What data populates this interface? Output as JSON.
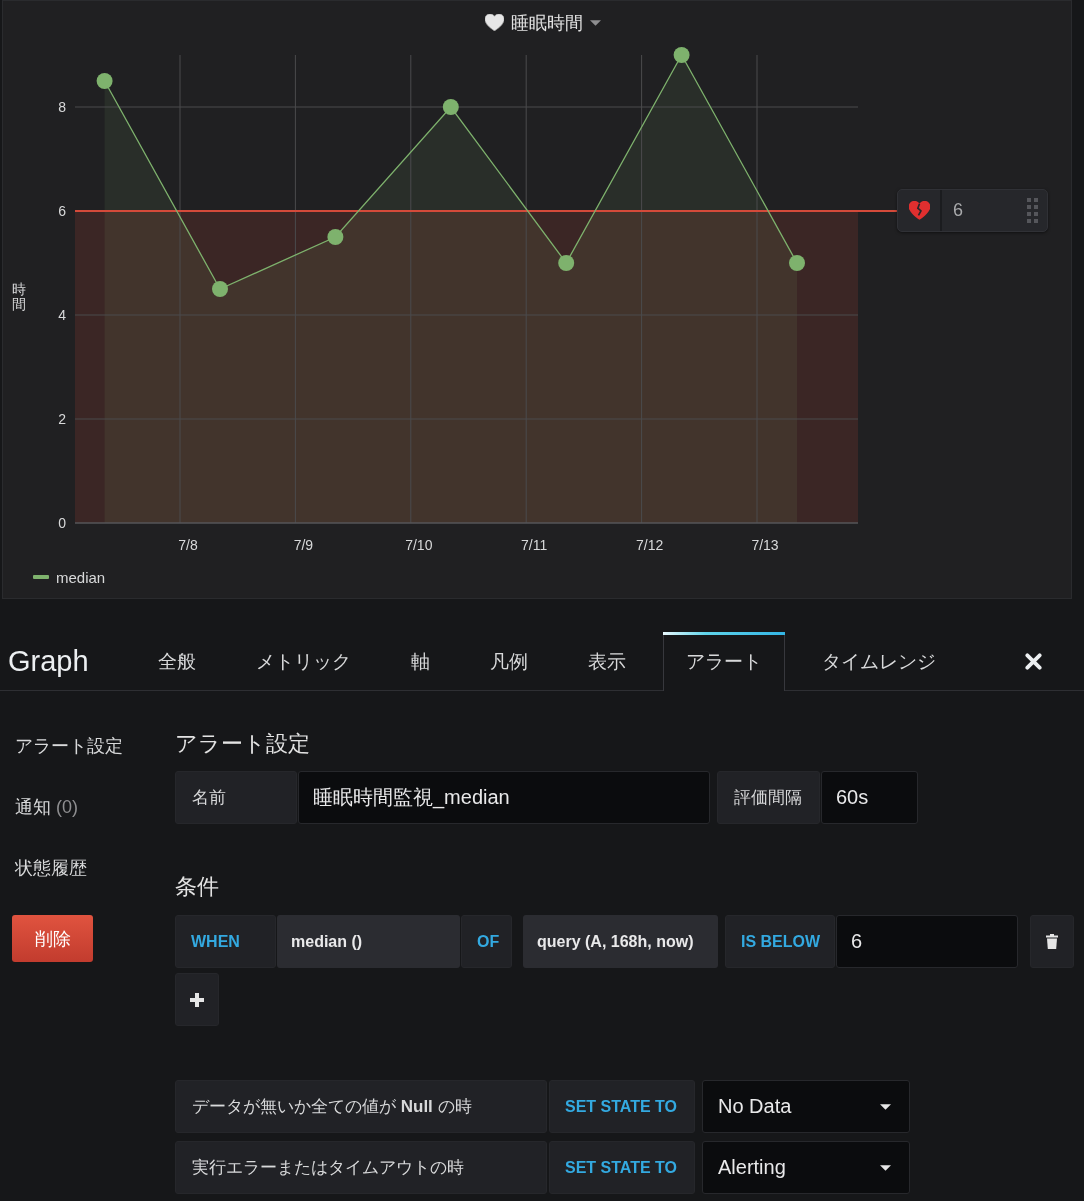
{
  "panel": {
    "title": "睡眠時間",
    "chart_data": {
      "type": "area",
      "ylabel": "時間",
      "categories": [
        null,
        "7/8",
        "7/9",
        "7/10",
        "7/11",
        "7/12",
        "7/13"
      ],
      "series": [
        {
          "name": "median",
          "color": "#7eb26d",
          "values": [
            8.5,
            4.5,
            5.5,
            8,
            5,
            9,
            5
          ]
        }
      ],
      "ylim": [
        0,
        9
      ],
      "yticks": [
        0,
        2,
        4,
        6,
        8
      ],
      "grid": true,
      "ref_lines": [
        {
          "axis": "y",
          "value": 6,
          "color": "#d44a3a"
        }
      ],
      "bands": [
        {
          "axis": "y",
          "from": 0,
          "to": 6,
          "color": "#d44a3a"
        }
      ]
    },
    "threshold_handle": {
      "value": "6"
    }
  },
  "editor": {
    "title": "Graph",
    "tabs": [
      {
        "label": "全般",
        "selected": false
      },
      {
        "label": "メトリック",
        "selected": false
      },
      {
        "label": "軸",
        "selected": false
      },
      {
        "label": "凡例",
        "selected": false
      },
      {
        "label": "表示",
        "selected": false
      },
      {
        "label": "アラート",
        "selected": true
      },
      {
        "label": "タイムレンジ",
        "selected": false
      }
    ]
  },
  "side_nav": {
    "items": [
      {
        "label": "アラート設定"
      },
      {
        "label": "通知",
        "count": "(0)"
      },
      {
        "label": "状態履歴"
      }
    ],
    "delete_button": "削除"
  },
  "alert_settings": {
    "heading": "アラート設定",
    "fields": [
      {
        "label": "名前",
        "value": "睡眠時間監視_median"
      },
      {
        "label": "評価間隔",
        "value": "60s"
      }
    ]
  },
  "conditions": {
    "heading": "条件",
    "rows": [
      {
        "when": "WHEN",
        "reducer": "median ()",
        "of": "OF",
        "query": "query (A, 168h, now)",
        "evaluator": "IS BELOW",
        "threshold": "6"
      }
    ]
  },
  "state_rules": [
    {
      "condition": "データが無いか全ての値が **Null** の時",
      "action": "SET STATE TO",
      "state": "No Data"
    },
    {
      "condition": "実行エラーまたはタイムアウトの時",
      "action": "SET STATE TO",
      "state": "Alerting"
    }
  ]
}
